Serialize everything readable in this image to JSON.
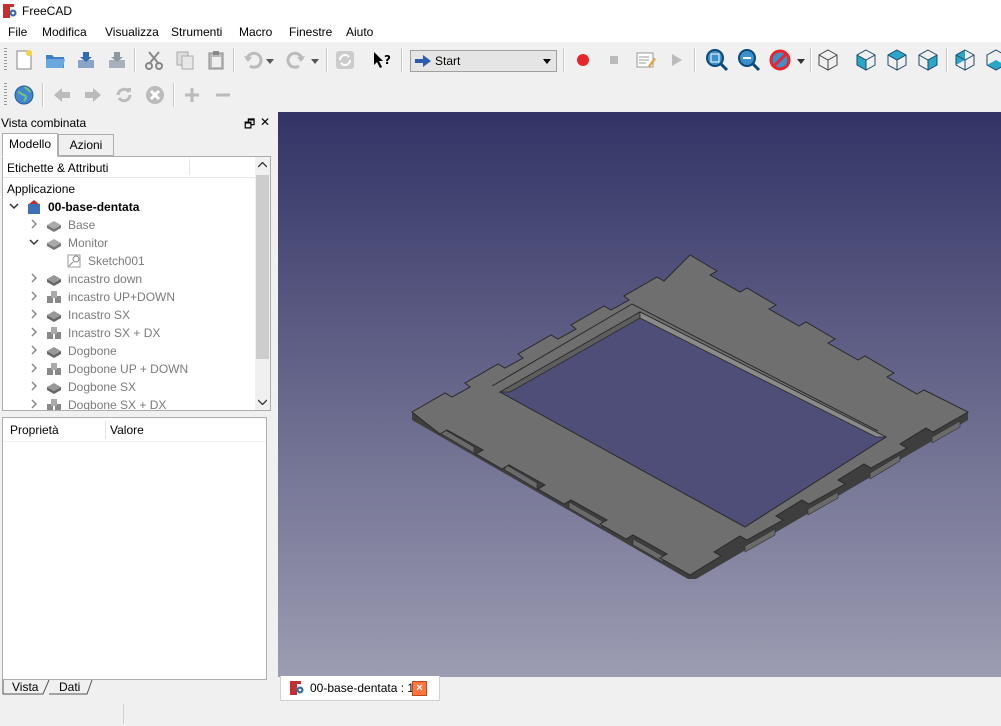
{
  "window": {
    "title": "FreeCAD"
  },
  "menu": [
    "File",
    "Modifica",
    "Visualizza",
    "Strumenti",
    "Macro",
    "Finestre",
    "Aiuto"
  ],
  "workbench": {
    "selected": "Start"
  },
  "combo_view": {
    "title": "Vista combinata",
    "tabs": [
      "Modello",
      "Azioni"
    ],
    "tree_header": "Etichette & Attributi",
    "tree": [
      {
        "label": "Applicazione"
      },
      {
        "label": "00-base-dentata"
      },
      {
        "label": "Base"
      },
      {
        "label": "Monitor"
      },
      {
        "label": "Sketch001"
      },
      {
        "label": "incastro down"
      },
      {
        "label": "incastro UP+DOWN"
      },
      {
        "label": "Incastro SX"
      },
      {
        "label": "Incastro SX + DX"
      },
      {
        "label": "Dogbone"
      },
      {
        "label": "Dogbone UP + DOWN"
      },
      {
        "label": "Dogbone SX"
      },
      {
        "label": "Dogbone SX + DX"
      }
    ],
    "properties": {
      "col1": "Proprietà",
      "col2": "Valore"
    },
    "bottom_tabs": [
      "Vista",
      "Dati"
    ]
  },
  "document_tab": {
    "label": "00-base-dentata : 1"
  },
  "colors": {
    "viewport_top": "#333366",
    "viewport_bottom": "#9c9cb2",
    "model_fill": "#6f6f6f"
  }
}
